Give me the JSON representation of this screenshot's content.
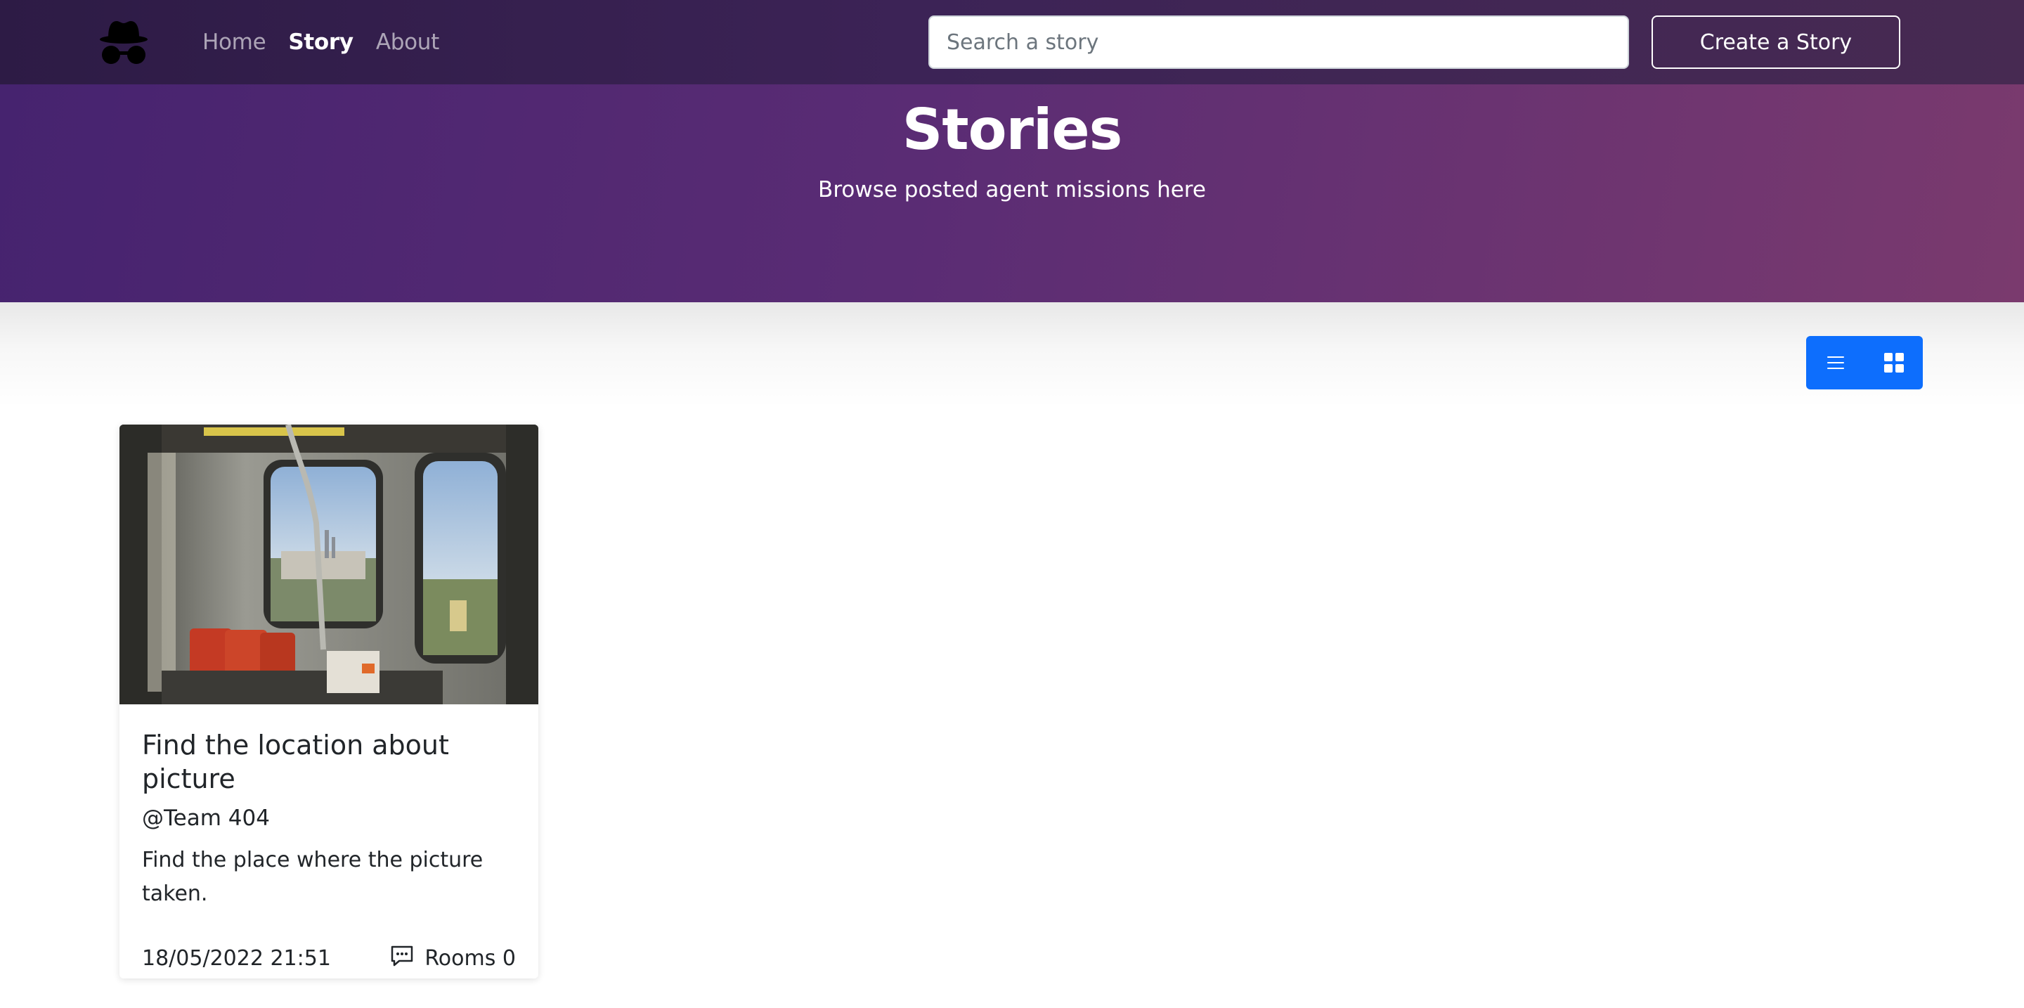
{
  "navbar": {
    "links": [
      {
        "label": "Home",
        "active": false
      },
      {
        "label": "Story",
        "active": true
      },
      {
        "label": "About",
        "active": false
      }
    ],
    "search": {
      "placeholder": "Search a story",
      "value": ""
    },
    "create_label": "Create a Story",
    "logo_icon": "spy-incognito-icon"
  },
  "hero": {
    "title": "Stories",
    "subtitle": "Browse posted agent missions here"
  },
  "view_toggle": {
    "options": [
      "list-view-icon",
      "grid-view-icon"
    ],
    "selected": "grid",
    "color": "#0d6efd"
  },
  "stories": [
    {
      "title": "Find the location about picture",
      "author": "@Team 404",
      "description": "Find the place where the picture taken.",
      "date": "18/05/2022 21:51",
      "rooms_label": "Rooms 0"
    }
  ],
  "colors": {
    "navbar": "#3c2356",
    "hero_start": "#46236f",
    "hero_end": "#7a3a6e",
    "accent": "#0d6efd"
  }
}
